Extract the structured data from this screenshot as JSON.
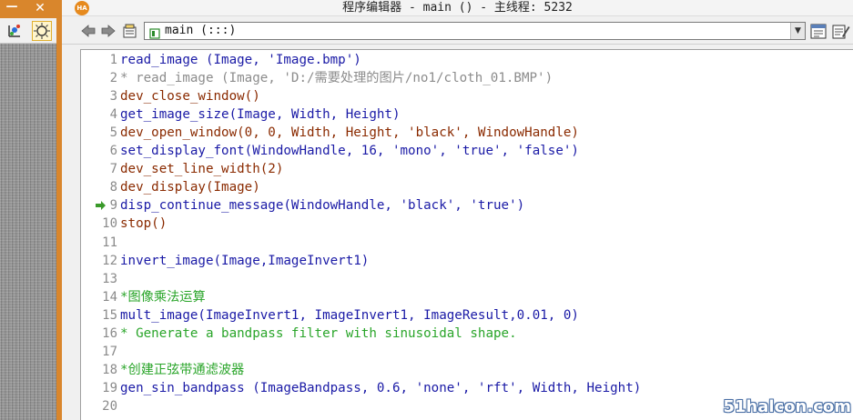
{
  "left_window": {
    "minimize_glyph": "—",
    "close_glyph": "✕"
  },
  "window": {
    "title": "程序编辑器 - main () - 主线程: 5232",
    "app_icon_text": "HA"
  },
  "toolbar": {
    "procedure": "main (:::)"
  },
  "code_lines": [
    {
      "num": "1",
      "text": "read_image (Image, 'Image.bmp')",
      "kind": "op"
    },
    {
      "num": "2",
      "text": "* read_image (Image, 'D:/需要处理的图片/no1/cloth_01.BMP')",
      "kind": "cmd"
    },
    {
      "num": "3",
      "text": "dev_close_window()",
      "kind": "kw"
    },
    {
      "num": "4",
      "text": "get_image_size(Image, Width, Height)",
      "kind": "op"
    },
    {
      "num": "5",
      "text": "dev_open_window(0, 0, Width, Height, 'black', WindowHandle)",
      "kind": "kw"
    },
    {
      "num": "6",
      "text": "set_display_font(WindowHandle, 16, 'mono', 'true', 'false')",
      "kind": "op"
    },
    {
      "num": "7",
      "text": "dev_set_line_width(2)",
      "kind": "kw"
    },
    {
      "num": "8",
      "text": "dev_display(Image)",
      "kind": "kw"
    },
    {
      "num": "9",
      "text": "disp_continue_message(WindowHandle, 'black', 'true')",
      "kind": "op"
    },
    {
      "num": "10",
      "text": "stop()",
      "kind": "kw"
    },
    {
      "num": "11",
      "text": "",
      "kind": "op"
    },
    {
      "num": "12",
      "text": "invert_image(Image,ImageInvert1)",
      "kind": "op"
    },
    {
      "num": "13",
      "text": "",
      "kind": "op"
    },
    {
      "num": "14",
      "text": "*图像乘法运算",
      "kind": "cm"
    },
    {
      "num": "15",
      "text": "mult_image(ImageInvert1, ImageInvert1, ImageResult,0.01, 0)",
      "kind": "op"
    },
    {
      "num": "16",
      "text": "* Generate a bandpass filter with sinusoidal shape.",
      "kind": "cm"
    },
    {
      "num": "17",
      "text": "",
      "kind": "op"
    },
    {
      "num": "18",
      "text": "*创建正弦带通滤波器",
      "kind": "cm"
    },
    {
      "num": "19",
      "text": "gen_sin_bandpass (ImageBandpass, 0.6, 'none', 'rft', Width, Height)",
      "kind": "op"
    },
    {
      "num": "20",
      "text": "",
      "kind": "op"
    }
  ],
  "program_counter_line": "9",
  "watermark": "51halcon.com",
  "colors": {
    "operator": "#1a1aa6",
    "control": "#8a2a00",
    "comment": "#2aa52a",
    "commented_code": "#8c8c8c",
    "accent": "#d9862c"
  }
}
